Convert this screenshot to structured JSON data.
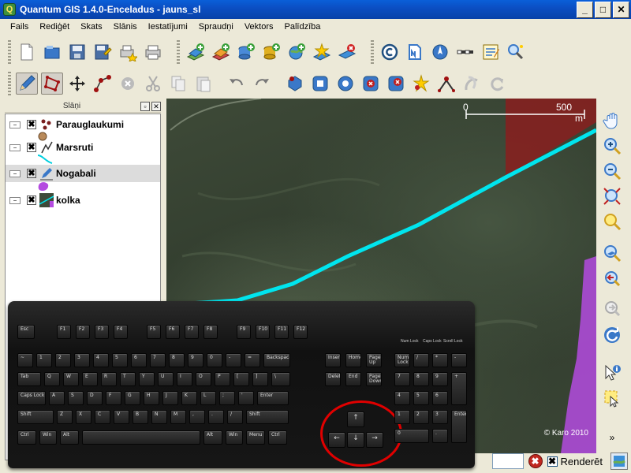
{
  "window": {
    "title": "Quantum GIS 1.4.0-Enceladus - jauns_sl",
    "app_icon": "qgis-icon",
    "buttons": [
      "minimize",
      "maximize",
      "close"
    ]
  },
  "menu": [
    "Fails",
    "Rediģēt",
    "Skats",
    "Slānis",
    "Iestatījumi",
    "Spraudņi",
    "Vektors",
    "Palīdzība"
  ],
  "toolbar_top_icons": [
    "new-project-icon",
    "open-project-icon",
    "save-project-icon",
    "save-as-icon",
    "print-composer-icon",
    "print-icon",
    "add-vector-layer-icon",
    "add-raster-layer-icon",
    "add-postgis-layer-icon",
    "add-spatialite-layer-icon",
    "add-wms-layer-icon",
    "new-vector-layer-icon",
    "remove-layer-icon",
    "copyright-label-icon",
    "north-arrow-icon",
    "scale-bar-icon",
    "gps-icon",
    "compass-icon",
    "identify-icon"
  ],
  "toolbar_edit_icons": [
    "toggle-editing-icon",
    "capture-polygon-icon",
    "move-feature-icon",
    "node-tool-icon",
    "delete-selected-icon",
    "cut-features-icon",
    "copy-features-icon",
    "paste-features-icon",
    "undo-icon",
    "redo-icon",
    "simplify-icon",
    "add-ring-icon",
    "add-island-icon",
    "delete-ring-icon",
    "delete-part-icon",
    "reshape-icon",
    "split-features-icon",
    "merge-icon",
    "rotate-icon"
  ],
  "layers_panel": {
    "title": "Slāņi",
    "layers": [
      {
        "name": "Parauglaukumi",
        "checked": "✖",
        "selected": false,
        "symbol": "point"
      },
      {
        "name": "Marsruti",
        "checked": "✖",
        "selected": false,
        "symbol": "line"
      },
      {
        "name": "Nogabali",
        "checked": "✖",
        "selected": true,
        "symbol": "polygon"
      },
      {
        "name": "kolka",
        "checked": "✖",
        "selected": false,
        "symbol": "raster"
      }
    ]
  },
  "map": {
    "scale_start": "0",
    "scale_end": "500",
    "scale_unit": "m",
    "copyright": "© Karo 2010",
    "line_color": "#00e5ee",
    "polygon_color": "#b44be0",
    "red_area_color": "#8a1f1f"
  },
  "right_toolbar_icons": [
    "pan-icon",
    "zoom-in-icon",
    "zoom-out-icon",
    "zoom-full-icon",
    "zoom-selection-icon",
    "zoom-layer-icon",
    "zoom-last-icon",
    "zoom-next-icon",
    "refresh-icon",
    "identify-features-icon",
    "select-features-icon",
    "more-icon"
  ],
  "status": {
    "render_label": "Renderēt",
    "render_checked": "✖",
    "stop_label": "✖"
  },
  "keyboard": {
    "function_keys": [
      "Esc",
      "F1",
      "F2",
      "F3",
      "F4",
      "F5",
      "F6",
      "F7",
      "F8",
      "F9",
      "F10",
      "F11",
      "F12"
    ],
    "nav_keys": [
      "Insert",
      "Home",
      "Page Up",
      "Delete",
      "End",
      "Page Down"
    ],
    "locks": [
      "Num Lock",
      "Caps Lock",
      "Scroll Lock"
    ],
    "number_row": [
      "~",
      "1",
      "2",
      "3",
      "4",
      "5",
      "6",
      "7",
      "8",
      "9",
      "0",
      "-",
      "=",
      "Backspace"
    ],
    "row_q": [
      "Tab",
      "Q",
      "W",
      "E",
      "R",
      "T",
      "Y",
      "U",
      "I",
      "O",
      "P",
      "[",
      "]",
      "\\"
    ],
    "row_a": [
      "Caps Lock",
      "A",
      "S",
      "D",
      "F",
      "G",
      "H",
      "J",
      "K",
      "L",
      ";",
      "'",
      "Enter"
    ],
    "row_z": [
      "Shift",
      "Z",
      "X",
      "C",
      "V",
      "B",
      "N",
      "M",
      ",",
      ".",
      "/",
      "Shift"
    ],
    "row_space": [
      "Ctrl",
      "Win",
      "Alt",
      "",
      "Alt",
      "Win",
      "Menu",
      "Ctrl"
    ],
    "arrows": {
      "up": "↑",
      "left": "←",
      "down": "↓",
      "right": "→"
    },
    "numpad": [
      "Num Lock",
      "/",
      "*",
      "-",
      "7",
      "8",
      "9",
      "+",
      "4",
      "5",
      "6",
      "1",
      "2",
      "3",
      "Enter",
      "0",
      "."
    ]
  }
}
